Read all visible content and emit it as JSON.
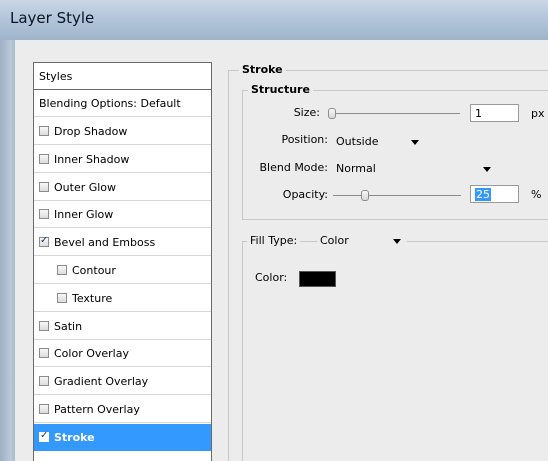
{
  "window": {
    "title": "Layer Style"
  },
  "styles_list": {
    "header": "Styles",
    "blending": "Blending Options: Default",
    "items": [
      {
        "label": "Drop Shadow",
        "checked": false,
        "indent": false,
        "selected": false
      },
      {
        "label": "Inner Shadow",
        "checked": false,
        "indent": false,
        "selected": false
      },
      {
        "label": "Outer Glow",
        "checked": false,
        "indent": false,
        "selected": false
      },
      {
        "label": "Inner Glow",
        "checked": false,
        "indent": false,
        "selected": false
      },
      {
        "label": "Bevel and Emboss",
        "checked": true,
        "indent": false,
        "selected": false
      },
      {
        "label": "Contour",
        "checked": false,
        "indent": true,
        "selected": false
      },
      {
        "label": "Texture",
        "checked": false,
        "indent": true,
        "selected": false
      },
      {
        "label": "Satin",
        "checked": false,
        "indent": false,
        "selected": false
      },
      {
        "label": "Color Overlay",
        "checked": false,
        "indent": false,
        "selected": false
      },
      {
        "label": "Gradient Overlay",
        "checked": false,
        "indent": false,
        "selected": false
      },
      {
        "label": "Pattern Overlay",
        "checked": false,
        "indent": false,
        "selected": false
      },
      {
        "label": "Stroke",
        "checked": true,
        "indent": false,
        "selected": true
      }
    ]
  },
  "stroke": {
    "section_title": "Stroke",
    "structure_title": "Structure",
    "size": {
      "label": "Size:",
      "value": "1",
      "unit": "px",
      "slider_fraction": 0.0
    },
    "position": {
      "label": "Position:",
      "value": "Outside"
    },
    "blend_mode": {
      "label": "Blend Mode:",
      "value": "Normal"
    },
    "opacity": {
      "label": "Opacity:",
      "value": "25",
      "unit": "%",
      "slider_fraction": 0.25
    },
    "fill_type": {
      "label": "Fill Type:",
      "value": "Color"
    },
    "color": {
      "label": "Color:",
      "swatch": "#000000"
    }
  },
  "colors": {
    "selection": "#3399ff",
    "dialog_bg": "#ececec"
  }
}
